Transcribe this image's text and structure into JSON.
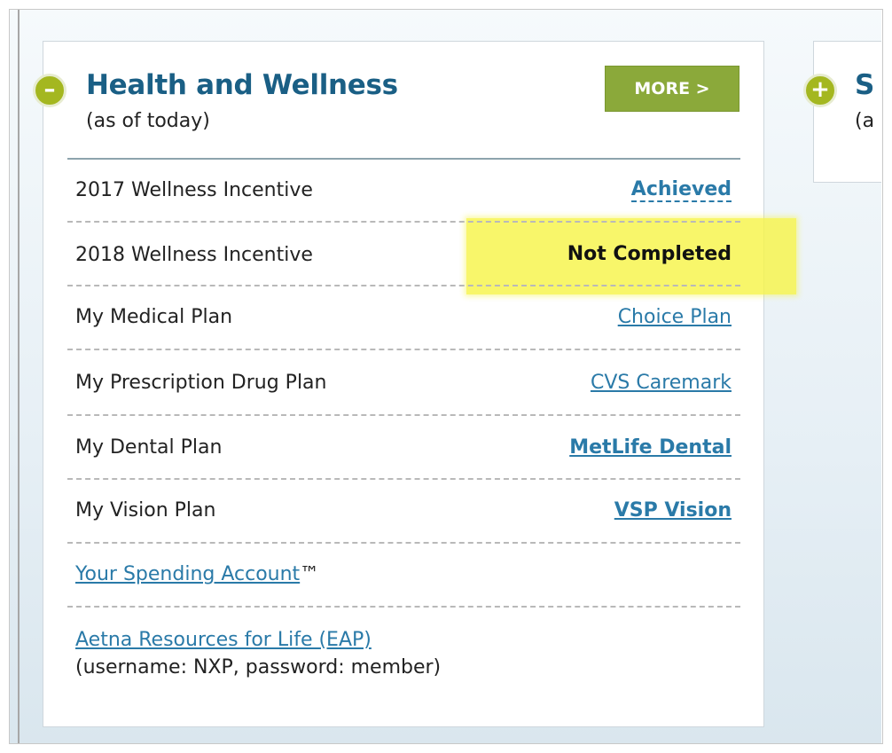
{
  "health_card": {
    "toggle_symbol": "–",
    "title": "Health and Wellness",
    "subtitle": "(as of today)",
    "more_label": "MORE >",
    "rows": [
      {
        "label": "2017 Wellness Incentive",
        "value": "Achieved"
      },
      {
        "label": "2018 Wellness Incentive",
        "value": "Not Completed"
      },
      {
        "label": "My Medical Plan",
        "value": "Choice Plan"
      },
      {
        "label": "My Prescription Drug Plan",
        "value": "CVS Caremark"
      },
      {
        "label": "My Dental Plan",
        "value": "MetLife Dental"
      },
      {
        "label": "My Vision Plan",
        "value": "VSP Vision"
      }
    ],
    "spending_account": {
      "link": "Your Spending Account",
      "suffix": "™"
    },
    "eap": {
      "link": "Aetna Resources for Life (EAP)",
      "note": "(username: NXP, password: member)"
    }
  },
  "second_card": {
    "toggle_symbol": "+",
    "title": "S",
    "subtitle": "(a"
  },
  "colors": {
    "title": "#1a5f85",
    "link": "#2a7aa8",
    "more_button": "#8ba93a",
    "toggle": "#a4b720",
    "highlight": "#f7f54a"
  }
}
